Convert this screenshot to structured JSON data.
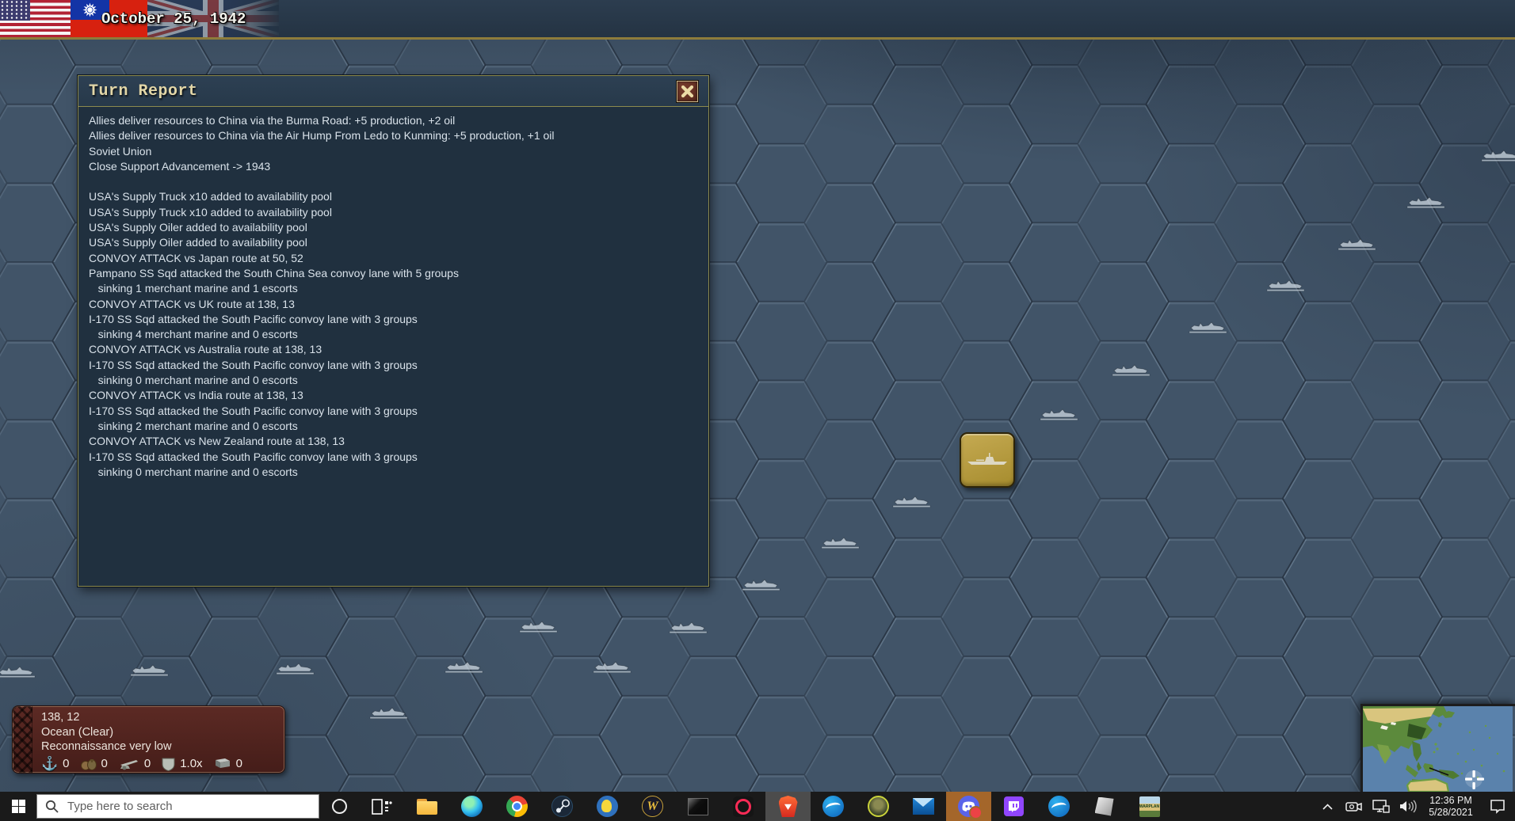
{
  "top_bar": {
    "date": "October 25, 1942"
  },
  "dialog": {
    "title": "Turn Report",
    "lines": [
      "Allies deliver resources to China via the Burma Road: +5 production, +2 oil",
      "Allies deliver resources to China via the Air Hump From Ledo to Kunming: +5 production, +1 oil",
      "Soviet Union",
      "Close Support Advancement -> 1943",
      "",
      "USA's Supply Truck x10 added to availability pool",
      "USA's Supply Truck x10 added to availability pool",
      "USA's Supply Oiler added to availability pool",
      "USA's Supply Oiler added to availability pool",
      "CONVOY ATTACK vs Japan route at 50, 52",
      "Pampano SS Sqd attacked the South China Sea convoy lane with 5 groups",
      "   sinking 1 merchant marine and 1 escorts",
      "CONVOY ATTACK vs UK route at 138, 13",
      "I-170 SS Sqd attacked the South Pacific convoy lane with 3 groups",
      "   sinking 4 merchant marine and 0 escorts",
      "CONVOY ATTACK vs Australia route at 138, 13",
      "I-170 SS Sqd attacked the South Pacific convoy lane with 3 groups",
      "   sinking 0 merchant marine and 0 escorts",
      "CONVOY ATTACK vs India route at 138, 13",
      "I-170 SS Sqd attacked the South Pacific convoy lane with 3 groups",
      "   sinking 2 merchant marine and 0 escorts",
      "CONVOY ATTACK vs New Zealand route at 138, 13",
      "I-170 SS Sqd attacked the South Pacific convoy lane with 3 groups",
      "   sinking 0 merchant marine and 0 escorts"
    ]
  },
  "tile_info": {
    "coords": "138, 12",
    "terrain": "Ocean (Clear)",
    "recon": "Reconnaissance very low",
    "stats": [
      {
        "icon": "anchor-icon",
        "value": "0"
      },
      {
        "icon": "supplies-icon",
        "value": "0"
      },
      {
        "icon": "artillery-icon",
        "value": "0"
      },
      {
        "icon": "shield-icon",
        "value": "1.0x"
      },
      {
        "icon": "steel-icon",
        "value": "0"
      }
    ]
  },
  "map": {
    "unit_icon": "submarine-counter",
    "convoy_marker_icon": "convoy-ship-marker",
    "flags": [
      "usa-flag",
      "china-flag",
      "uk-flag"
    ]
  },
  "taskbar": {
    "search_placeholder": "Type here to search",
    "clock": {
      "time": "12:36 PM",
      "date": "5/28/2021"
    },
    "apps": [
      "task-view",
      "file-explorer",
      "edge",
      "chrome",
      "steam",
      "fallout",
      "world-of-warcraft",
      "terminal",
      "opera-gx",
      "brave",
      "battlenet",
      "game-avatar",
      "mail",
      "discord",
      "twitch",
      "battlenet-2",
      "paint3d",
      "warplan"
    ],
    "tray": [
      "hidden-icons-chevron",
      "camera",
      "display",
      "speaker",
      "clock",
      "action-center"
    ]
  },
  "colors": {
    "ocean": "#415468",
    "accent_gold_line": "#8d7c3b",
    "dialog_bg": "#20303f",
    "dialog_border": "#8c8a4e",
    "title_cream": "#e3d7a8",
    "panel_maroon": "#5c2a24",
    "unit_gold": "#b2983c",
    "taskbar_dark": "#1a1a1a"
  }
}
